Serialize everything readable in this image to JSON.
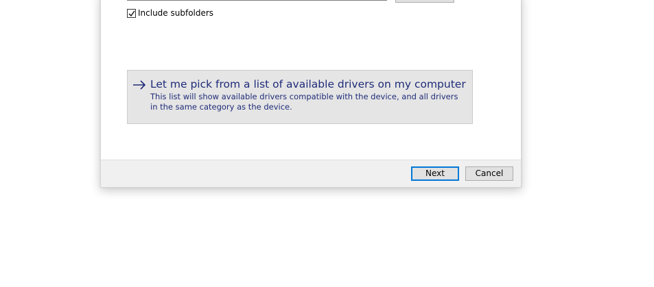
{
  "search": {
    "include_subfolders_label": "Include subfolders",
    "include_subfolders_checked": true
  },
  "pick_option": {
    "icon": "arrow-right-icon",
    "title": "Let me pick from a list of available drivers on my computer",
    "description": "This list will show available drivers compatible with the device, and all drivers in the same category as the device."
  },
  "footer": {
    "next_label": "Next",
    "cancel_label": "Cancel"
  },
  "colors": {
    "link_text": "#1e2b78",
    "default_button_border": "#0078d7",
    "footer_background": "#f0f0f0",
    "option_background": "#e5e5e5"
  }
}
